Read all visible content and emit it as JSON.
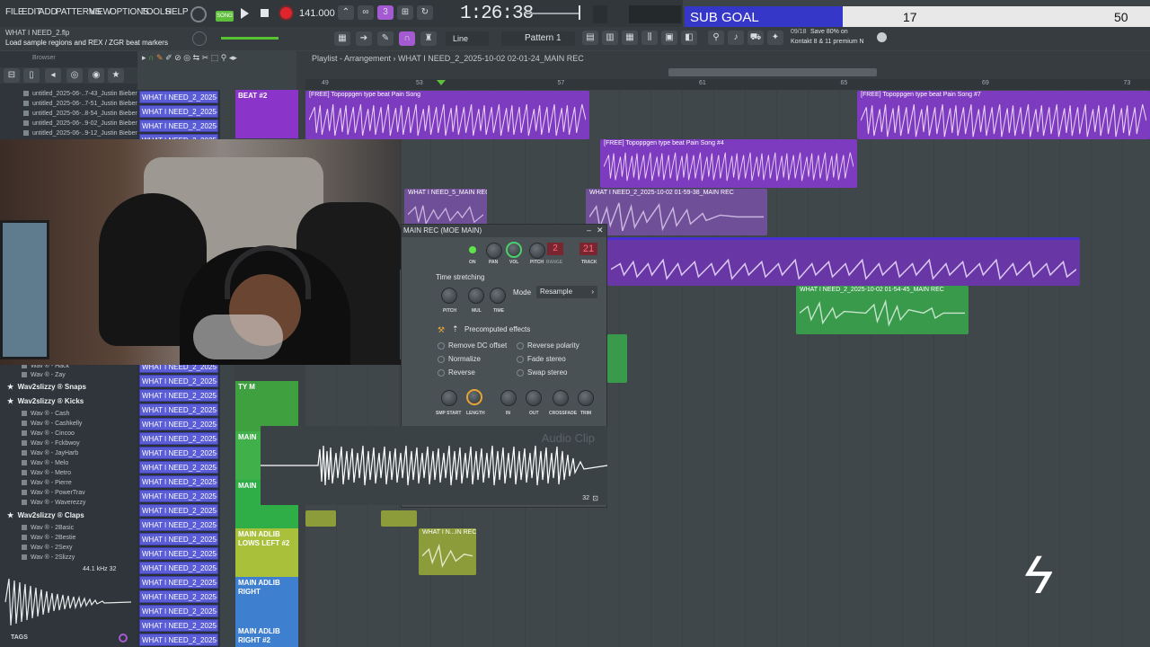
{
  "menu": [
    "FILE",
    "EDIT",
    "ADD",
    "PATTERNS",
    "VIEW",
    "OPTIONS",
    "TOOLS",
    "HELP"
  ],
  "transport": {
    "tempo": "141.000",
    "time": "1:26:38",
    "song_label": "SONG"
  },
  "hint": {
    "project": "WHAT I NEED_2.flp",
    "message": "Load sample regions and REX / ZGR beat markers"
  },
  "toolbar": {
    "snap": "Line",
    "pattern": "Pattern 1",
    "news_date": "09/18",
    "news_line1": "Save 80% on",
    "news_line2": "Kontakt 8 & 11 premium N"
  },
  "subgoal": {
    "label": "SUB GOAL",
    "current": "17",
    "goal": "50",
    "progress": 0.34
  },
  "browser": {
    "title": "Browser",
    "recent": [
      "untitled_2025-06-..7-43_Justin Bieber",
      "untitled_2025-06-..7-51_Justin Bieber",
      "untitled_2025-06-..8-54_Justin Bieber",
      "untitled_2025-06-..9-02_Justin Bieber",
      "untitled_2025-06-..9-12_Justin Bieber"
    ],
    "items_a": [
      "Wav ® - Hack",
      "Wav ® - Zay"
    ],
    "folder_snaps": "Wav2slizzy ® Snaps",
    "folder_kicks": "Wav2slizzy ® Kicks",
    "kicks": [
      "Wav ® - Cash",
      "Wav ® - Cashkelly",
      "Wav ® - Cincoo",
      "Wav ® - Fckbwoy",
      "Wav ® - JayHarb",
      "Wav ® - Melo",
      "Wav ® - Metro",
      "Wav ® - Pierre",
      "Wav ® - PowerTrav",
      "Wav ® - Waverezzy"
    ],
    "folder_claps": "Wav2slizzy ® Claps",
    "claps": [
      "Wav ® - 2Basic",
      "Wav ® - 2Bestie",
      "Wav ® - 2Sexy",
      "Wav ® - 2Slizzy"
    ],
    "sample_info": "44.1 kHz 32",
    "tags_label": "TAGS"
  },
  "channels": [
    "WHAT I NEED_2_2025-10..",
    "WHAT I NEED_2_2025-10..",
    "WHAT I NEED_2_2025-10..",
    "WHAT I NEED_2_2025-10.."
  ],
  "channels_lower": [
    "WHAT I NEED_2_2025-10..",
    "WHAT I NEED_2_2025-10..",
    "WHAT I NEED_2_2025-10..",
    "WHAT I NEED_2_2025-10..",
    "WHAT I NEED_2_2025-10..",
    "WHAT I NEED_2_2025-10..",
    "WHAT I NEED_2_2025-10..",
    "WHAT I NEED_2_2025-10..",
    "WHAT I NEED_2_2025-10..",
    "WHAT I NEED_2_2025-10..",
    "WHAT I NEED_2_2025-10..",
    "WHAT I NEED_2_2025-10..",
    "WHAT I NEED_2_2025-10..",
    "WHAT I NEED_2_2025-10..",
    "WHAT I NEED_2_2025-10..",
    "WHAT I NEED_2_2025-10..",
    "WHAT I NEED_2_2025-10..",
    "WHAT I NEED_2_2025-10..",
    "WHAT I NEED_2_2025-10..",
    "WHAT I NEED_2_2025-10.."
  ],
  "playlist": {
    "title": "Playlist - Arrangement",
    "arrangement": "WHAT I NEED_2_2025-10-02 02-01-24_MAIN REC",
    "ruler": [
      "49",
      "",
      "53",
      "",
      "",
      "57",
      "",
      "",
      "61",
      "",
      "",
      "65",
      "",
      "",
      "69",
      "",
      "",
      "73"
    ],
    "tracks": [
      "BEAT #2",
      "TY M",
      "MAIN",
      "MAIN",
      "MAIN ADLIB LOWS LEFT #2",
      "MAIN ADLIB RIGHT",
      "MAIN ADLIB RIGHT #2"
    ],
    "clips": [
      "[FREE] Topoppgen type beat  Pain Song",
      "[FREE] Topoppgen type beat  Pain Song #7",
      "[FREE] Topoppgen type beat  Pain Song #4",
      "WHAT I NEED_5_MAIN REC",
      "WHAT I NEED_2_2025-10-02 01-59-38_MAIN REC",
      "WHAT I NEED_2_2025-10-02 01-54-45_MAIN REC",
      "WHAT I N...IN REC"
    ]
  },
  "dialog": {
    "title": "MAIN REC (MOE MAIN)",
    "on": "ON",
    "pan": "PAN",
    "vol": "VOL",
    "pitch": "PITCH",
    "range": "RANGE",
    "track": "TRACK",
    "range_val": "2",
    "track_val": "21",
    "ts_label": "Time stretching",
    "ts_pitch": "PITCH",
    "ts_mul": "MUL",
    "ts_time": "TIME",
    "mode_label": "Mode",
    "mode_val": "Resample",
    "precomp": "Precomputed effects",
    "effects_left": [
      "Remove DC offset",
      "Normalize",
      "Reverse"
    ],
    "effects_right": [
      "Reverse polarity",
      "Fade stereo",
      "Swap stereo"
    ],
    "knobs": [
      "SMP START",
      "LENGTH",
      "IN",
      "OUT",
      "CROSSFADE",
      "TRIM"
    ],
    "watermark": "Audio Clip",
    "bits": "32"
  }
}
